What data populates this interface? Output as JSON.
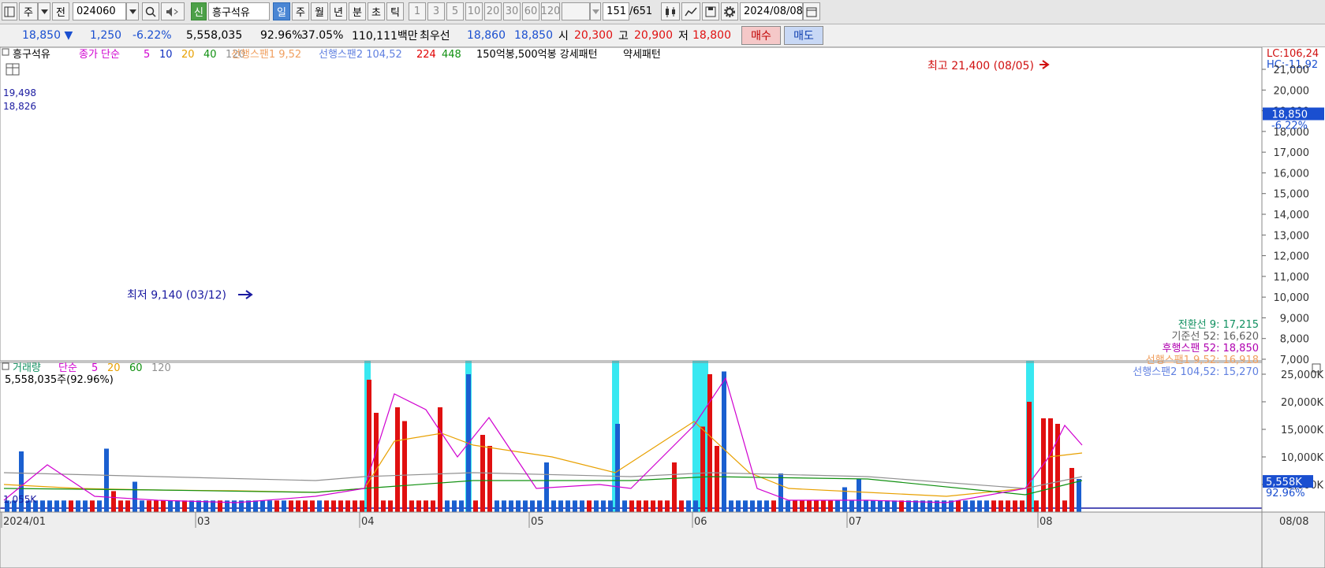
{
  "toolbar": {
    "stock_code": "024060",
    "stock_name": "흥구석유",
    "type_label": "주",
    "prev_label": "전",
    "new_badge": "신",
    "periods": [
      "일",
      "주",
      "월",
      "년",
      "분",
      "초",
      "틱"
    ],
    "active_period": "일",
    "intervals": [
      "1",
      "3",
      "5",
      "10",
      "20",
      "30",
      "60",
      "120"
    ],
    "count": "151",
    "count_total": "/651",
    "date": "2024/08/08"
  },
  "quote": {
    "price": "18,850",
    "change": "1,250",
    "change_pct": "-6.22%",
    "volume": "5,558,035",
    "vol_ratio": "92.96%",
    "turnover": "37.05%",
    "amount": "110,111백만",
    "best_label": "최우선",
    "ask": "18,860",
    "bid": "18,850",
    "open_label": "시",
    "open": "20,300",
    "high_label": "고",
    "high": "20,900",
    "low_label": "저",
    "low": "18,800",
    "buy_label": "매수",
    "sell_label": "매도"
  },
  "legend": {
    "name": "흥구석유",
    "close_simple": "종가 단순",
    "ma": [
      {
        "t": "5",
        "c": "#d000d0"
      },
      {
        "t": "10",
        "c": "#1030c0"
      },
      {
        "t": "20",
        "c": "#e8a000"
      },
      {
        "t": "40",
        "c": "#109010"
      },
      {
        "t": "120",
        "c": "#909090"
      }
    ],
    "span1": "선행스팬1 9,52",
    "span2": "선행스팬2 104,52",
    "ma2": [
      {
        "t": "224",
        "c": "#e00000"
      },
      {
        "t": "448",
        "c": "#109010"
      }
    ],
    "pattern": "150억봉,500억봉 강세패턴",
    "weak": "약세패턴"
  },
  "annotations": {
    "hline1": "19,498",
    "hline2": "18,826",
    "max_label": "최고 21,400 (08/05)",
    "min_label": "최저 9,140 (03/12)",
    "lc": "LC:106,24",
    "hc": "HC:-11,92",
    "cur_price": "18,850",
    "cur_pct": "-6.22%",
    "ichimoku": [
      {
        "t": "전환선 9: 17,215",
        "c": "#109060"
      },
      {
        "t": "기준선 52: 16,620",
        "c": "#606060"
      },
      {
        "t": "후행스팬 52: 18,850",
        "c": "#b000b0"
      },
      {
        "t": "선행스팬1 9,52: 16,918",
        "c": "#f0a060"
      },
      {
        "t": "선행스팬2 104,52: 15,270",
        "c": "#6080e0"
      }
    ],
    "vol_legend": "거래량",
    "vol_simple": "단순",
    "vol_ma": [
      {
        "t": "5",
        "c": "#d000d0"
      },
      {
        "t": "20",
        "c": "#e8a000"
      },
      {
        "t": "60",
        "c": "#109010"
      },
      {
        "t": "120",
        "c": "#909090"
      }
    ],
    "vol_total": "5,558,035주(92.96%)",
    "vol_ref": "1,055K",
    "vol_cur": "5,558K",
    "vol_pct": "92.96%",
    "end_date": "08/08"
  },
  "chart_data": {
    "type": "candlestick",
    "price_axis": {
      "ticks": [
        7000,
        8000,
        9000,
        10000,
        11000,
        12000,
        13000,
        14000,
        15000,
        16000,
        17000,
        18000,
        19000,
        20000,
        21000
      ]
    },
    "volume_axis": {
      "ticks": [
        "25,000K",
        "20,000K",
        "15,000K",
        "10,000K",
        "5,000K"
      ],
      "values": [
        25000,
        20000,
        15000,
        10000,
        5000
      ]
    },
    "x_labels": [
      "2024/01",
      "03",
      "04",
      "05",
      "06",
      "07",
      "08"
    ],
    "price": {
      "high": 21400,
      "low": 9140,
      "last": 18850
    },
    "volume": {
      "last_k": 5558
    }
  }
}
